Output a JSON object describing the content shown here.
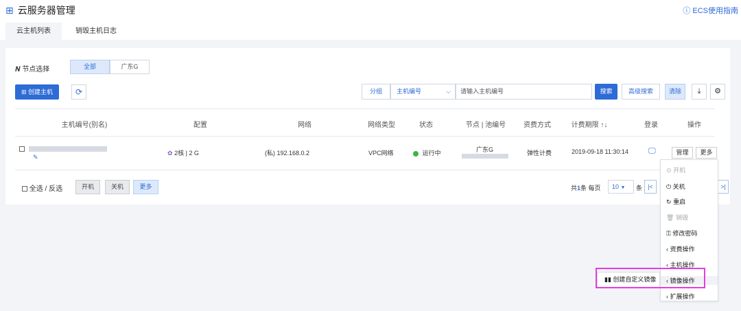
{
  "header": {
    "title": "云服务器管理",
    "guide_link": "ECS使用指南"
  },
  "tabs": [
    {
      "label": "云主机列表",
      "active": true
    },
    {
      "label": "销毁主机日志",
      "active": false
    }
  ],
  "node_select": {
    "label": "节点选择",
    "options": [
      "全部",
      "广东G"
    ],
    "selected": "全部"
  },
  "toolbar": {
    "create_label": "创建主机",
    "group_label": "分组",
    "field_select": "主机编号",
    "search_placeholder": "请输入主机编号",
    "search_label": "搜索",
    "advanced_label": "高级搜索",
    "clear_label": "清除"
  },
  "table": {
    "headers": [
      "主机编号(别名)",
      "配置",
      "网络",
      "网络类型",
      "状态",
      "节点 | 池编号",
      "资费方式",
      "计费期限 ↑↓",
      "登录",
      "操作"
    ],
    "row": {
      "config": "2核 | 2 G",
      "network": "(私) 192.168.0.2",
      "net_type": "VPC网络",
      "status": "运行中",
      "node": "广东G",
      "billing": "弹性计费",
      "expiry": "2019-09-18 11:30:14",
      "manage_label": "管理",
      "more_label": "更多"
    }
  },
  "footer": {
    "select_all": "全选 / 反选",
    "power_on": "开机",
    "power_off": "关机",
    "more": "更多",
    "total_prefix": "共",
    "total_count": "1",
    "total_suffix": "条 每页",
    "page_size": "10",
    "page_unit": "条"
  },
  "menu": {
    "items": [
      {
        "label": "开机",
        "disabled": true
      },
      {
        "label": "关机",
        "disabled": false
      },
      {
        "label": "重启",
        "disabled": false
      },
      {
        "label": "销毁",
        "disabled": true
      },
      {
        "label": "修改密码",
        "disabled": false
      },
      {
        "label": "资费操作",
        "disabled": false
      },
      {
        "label": "主机操作",
        "disabled": false
      },
      {
        "label": "镜像操作",
        "disabled": false
      },
      {
        "label": "扩展操作",
        "disabled": false
      }
    ]
  },
  "submenu": {
    "label": "创建自定义镜像"
  },
  "colors": {
    "accent": "#2d6bd6",
    "highlight": "#e63ce0",
    "running": "#3bb54a"
  }
}
